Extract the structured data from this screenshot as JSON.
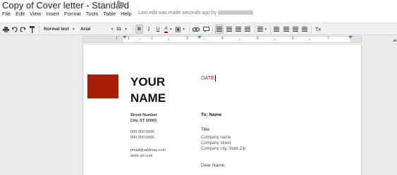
{
  "window": {
    "doc_title": "Copy of Cover letter - Standard",
    "last_edit": "Last edit was made seconds ago by"
  },
  "menu": [
    "File",
    "Edit",
    "View",
    "Insert",
    "Format",
    "Tools",
    "Table",
    "Help"
  ],
  "toolbar": {
    "style": "Normal text",
    "font": "Arial",
    "size": "11",
    "bold": "B",
    "italic": "I",
    "underline": "U",
    "text_color": "A",
    "clear_format": "Tx"
  },
  "ruler": {
    "numbers": [
      "1",
      "1",
      "2",
      "3",
      "4",
      "5",
      "6",
      "7"
    ]
  },
  "document": {
    "name_line1": "YOUR",
    "name_line2": "NAME",
    "date": "DATE",
    "street": "Street Number",
    "city": "City, ST 10003",
    "phone1": "000 000 0000",
    "phone2": "000 000 0000",
    "email": "email@address.com",
    "url": "work-url.com",
    "to_name": "To: Name",
    "title": "Title",
    "company_name": "Company name",
    "company_street": "Company street",
    "company_city": "Company city, State Zip",
    "greeting": "Dear Name,"
  },
  "colors": {
    "accent": "#a91e07",
    "page": "#ffffff",
    "background": "#ebebeb"
  },
  "icons": [
    "star-icon",
    "folder-icon",
    "print-icon",
    "undo-icon",
    "redo-icon",
    "paint-format-icon",
    "highlight-icon",
    "link-icon",
    "comment-icon",
    "align-left-icon",
    "align-center-icon",
    "align-right-icon",
    "justify-icon",
    "line-spacing-icon",
    "numbered-list-icon",
    "bulleted-list-icon",
    "decrease-indent-icon",
    "increase-indent-icon"
  ]
}
